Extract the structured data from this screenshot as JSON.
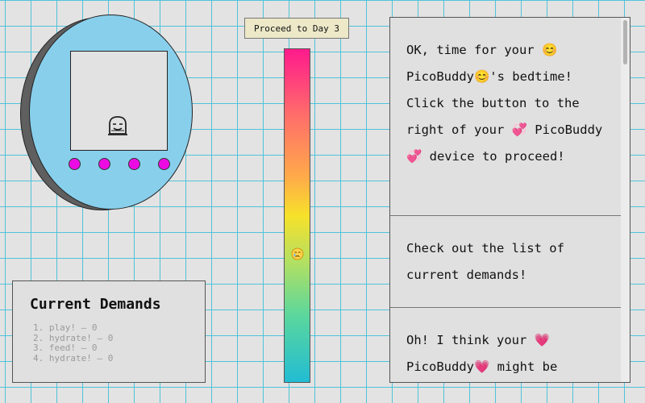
{
  "device": {
    "pet_icon": "sleeping-pet-face-icon",
    "body_color": "#88cfec",
    "button_color": "#ec0ce3",
    "buttons": [
      "device-button-1",
      "device-button-2",
      "device-button-3",
      "device-button-4"
    ]
  },
  "demands": {
    "title": "Current Demands",
    "items": [
      "1. play! – 0",
      "2. hydrate! – 0",
      "3. feed! – 0",
      "4. hydrate! – 0"
    ]
  },
  "proceed_button": {
    "label": "Proceed to Day 3"
  },
  "mood_meter": {
    "level": 0.62,
    "marker_icon": "crying-face-icon",
    "gradient_colors": [
      "#ff1a8c",
      "#ffa94a",
      "#f7e12a",
      "#5bd79d",
      "#22bcd3"
    ]
  },
  "messages": [
    "OK, time for your 😊 PicoBuddy😊's bedtime! Click the button to the right of your 💞 PicoBuddy💞 device to proceed!",
    "Check out the list of current demands!",
    "Oh! I think your 💗 PicoBuddy💗 might be"
  ]
}
